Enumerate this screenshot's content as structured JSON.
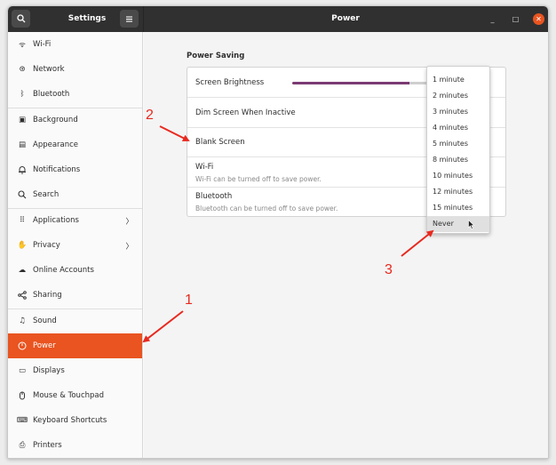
{
  "titlebar": {
    "left_title": "Settings",
    "main_title": "Power",
    "minimize": "_",
    "maximize": "□",
    "close": "✕"
  },
  "sidebar": {
    "items": [
      {
        "label": "Wi-Fi",
        "icon": "wifi-icon",
        "glyph": "ᯤ"
      },
      {
        "label": "Network",
        "icon": "network-icon",
        "glyph": "⊛"
      },
      {
        "label": "Bluetooth",
        "icon": "bluetooth-icon",
        "glyph": "ᛒ"
      },
      {
        "label": "Background",
        "icon": "background-icon",
        "glyph": "▣"
      },
      {
        "label": "Appearance",
        "icon": "appearance-icon",
        "glyph": "▤"
      },
      {
        "label": "Notifications",
        "icon": "bell-icon",
        "glyph": "♫"
      },
      {
        "label": "Search",
        "icon": "search-icon",
        "glyph": "⚲"
      },
      {
        "label": "Applications",
        "icon": "apps-icon",
        "glyph": "⠿",
        "chevron": "〉"
      },
      {
        "label": "Privacy",
        "icon": "hand-icon",
        "glyph": "✋",
        "chevron": "〉"
      },
      {
        "label": "Online Accounts",
        "icon": "cloud-icon",
        "glyph": "☁"
      },
      {
        "label": "Sharing",
        "icon": "share-icon",
        "glyph": "⋖"
      },
      {
        "label": "Sound",
        "icon": "music-icon",
        "glyph": "♫"
      },
      {
        "label": "Power",
        "icon": "power-icon",
        "glyph": "⏻"
      },
      {
        "label": "Displays",
        "icon": "display-icon",
        "glyph": "▭"
      },
      {
        "label": "Mouse & Touchpad",
        "icon": "mouse-icon",
        "glyph": "◫"
      },
      {
        "label": "Keyboard Shortcuts",
        "icon": "keyboard-icon",
        "glyph": "⌨"
      },
      {
        "label": "Printers",
        "icon": "printer-icon",
        "glyph": "⎙"
      }
    ]
  },
  "power_saving": {
    "section_title": "Power Saving",
    "rows": [
      {
        "label": "Screen Brightness"
      },
      {
        "label": "Dim Screen When Inactive"
      },
      {
        "label": "Blank Screen"
      },
      {
        "label": "Wi-Fi",
        "sub": "Wi-Fi can be turned off to save power."
      },
      {
        "label": "Bluetooth",
        "sub": "Bluetooth can be turned off to save power."
      }
    ],
    "brightness_level": 0.8
  },
  "blank_screen_options": [
    "1 minute",
    "2 minutes",
    "3 minutes",
    "4 minutes",
    "5 minutes",
    "8 minutes",
    "10 minutes",
    "12 minutes",
    "15 minutes",
    "Never"
  ],
  "annotations": {
    "one": "1",
    "two": "2",
    "three": "3"
  },
  "colors": {
    "accent": "#e95420",
    "annotation": "#e8291f",
    "slider": "#7a3a73"
  }
}
